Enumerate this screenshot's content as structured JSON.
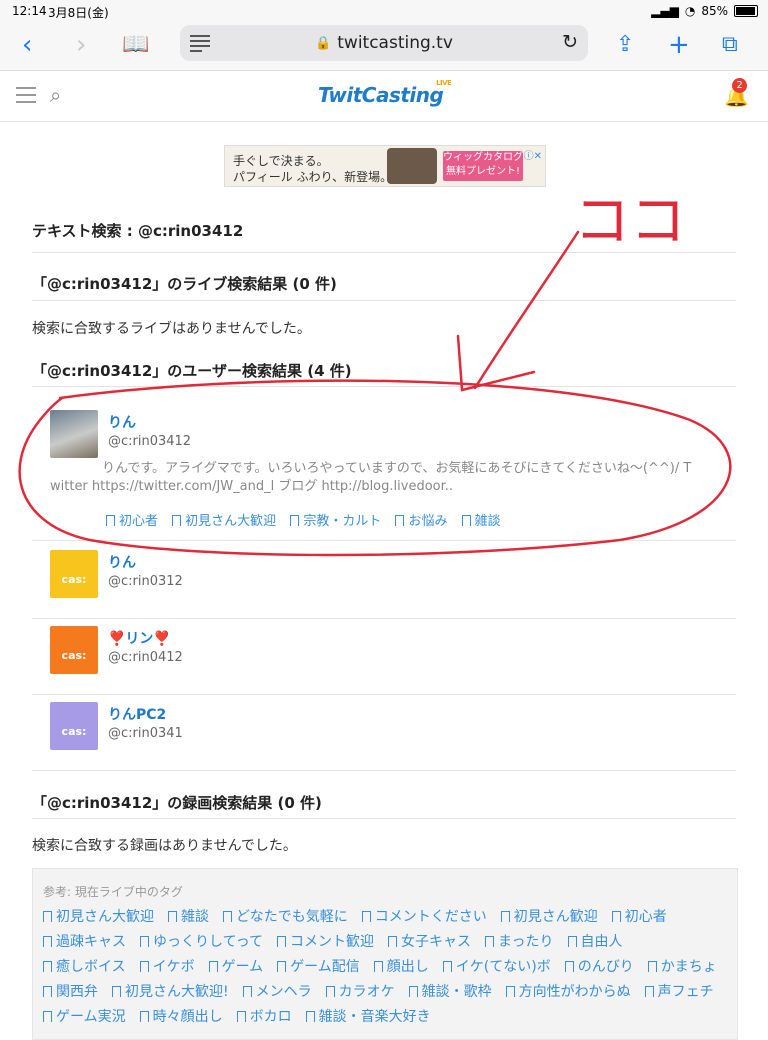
{
  "statusbar": {
    "time": "12:14",
    "date": "3月8日(金)",
    "battery": "85%",
    "battery_fraction": 0.85
  },
  "browser": {
    "url": "twitcasting.tv"
  },
  "site": {
    "logo": "TwitCasting",
    "logo_sup": "LIVE",
    "notifications": "2"
  },
  "ad": {
    "line1": "手ぐしで決まる。",
    "line2": "パフィール ふわり、新登場。",
    "cta": "ウィッグカタログ 無料プレゼント!"
  },
  "search": {
    "heading": "テキスト検索 : @c:rin03412",
    "live_heading": "「@c:rin03412」のライブ検索結果 (0 件)",
    "live_empty": "検索に合致するライブはありませんでした。",
    "user_heading": "「@c:rin03412」のユーザー検索結果 (4 件)",
    "record_heading": "「@c:rin03412」の録画検索結果 (0 件)",
    "record_empty": "検索に合致する録画はありませんでした。"
  },
  "users": [
    {
      "name": "りん",
      "id": "@c:rin03412",
      "desc_line1": "りんです。アライグマです。いろいろやっていますので、お気軽にあそびにきてくださいね〜(^^)/ T",
      "desc_line2": "witter   https://twitter.com/JW_and_l ブログ   http://blog.livedoor..",
      "tags": [
        "初心者",
        "初見さん大歓迎",
        "宗教・カルト",
        "お悩み",
        "雑談"
      ]
    },
    {
      "name": "りん",
      "id": "@c:rin0312",
      "color": "#f7c51e"
    },
    {
      "name": "❣️リン❣️",
      "id": "@c:rin0412",
      "color": "#f57a1d"
    },
    {
      "name": "りんPC2",
      "id": "@c:rin0341",
      "color": "#a79be8"
    }
  ],
  "cas_label": "cas:",
  "annotation": "ココ",
  "tags_box": {
    "label": "参考: 現在ライブ中のタグ",
    "tags": [
      "初見さん大歓迎",
      "雑談",
      "どなたでも気軽に",
      "コメントください",
      "初見さん歓迎",
      "初心者",
      "過疎キャス",
      "ゆっくりしてって",
      "コメント歓迎",
      "女子キャス",
      "まったり",
      "自由人",
      "癒しボイス",
      "イケボ",
      "ゲーム",
      "ゲーム配信",
      "顔出し",
      "イケ(てない)ボ",
      "のんびり",
      "かまちょ",
      "関西弁",
      "初見さん大歓迎!",
      "メンヘラ",
      "カラオケ",
      "雑談・歌枠",
      "方向性がわからぬ",
      "声フェチ",
      "ゲーム実況",
      "時々顔出し",
      "ボカロ",
      "雑談・音楽大好き"
    ]
  }
}
